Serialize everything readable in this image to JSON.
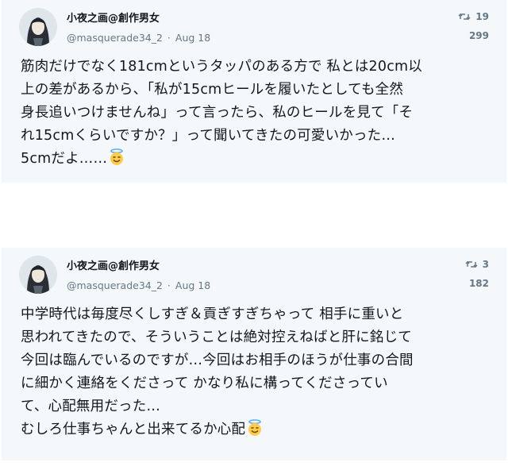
{
  "tweets": [
    {
      "display_name": "小夜之画@創作男女",
      "handle": "@masquerade34_2",
      "separator": "·",
      "date": "Aug 18",
      "retweets": "19",
      "likes": "299",
      "lines": [
        "筋肉だけでなく181cmというタッパのある方で 私とは20cm以",
        "上の差があるから、「私が15cmヒールを履いたとしても全然",
        "身長追いつけませんね」って言ったら、私のヒールを見て「そ",
        "れ15cmくらいですか？」って聞いてきたの可愛いかった…",
        "5cmだよ……"
      ],
      "trailing_emoji": "smiling-face-with-halo"
    },
    {
      "display_name": "小夜之画@創作男女",
      "handle": "@masquerade34_2",
      "separator": "·",
      "date": "Aug 18",
      "retweets": "3",
      "likes": "182",
      "lines": [
        "中学時代は毎度尽くしすぎ＆貢ぎすぎちゃって 相手に重いと",
        "思われてきたので、そういうことは絶対控えねばと肝に銘じて",
        "今回は臨んでいるのですが…今回はお相手のほうが仕事の合間",
        "に細かく連絡をくださって かなり私に構ってくださってい",
        "て、心配無用だった…",
        "むしろ仕事ちゃんと出来てるか心配"
      ],
      "trailing_emoji": "smiling-face-with-halo"
    }
  ],
  "icons": {
    "retweet": "retweet-icon",
    "emoji": "smiling-face-with-halo"
  },
  "colors": {
    "card_bg": "#f5f8fa",
    "name": "#14171a",
    "meta": "#657786"
  }
}
